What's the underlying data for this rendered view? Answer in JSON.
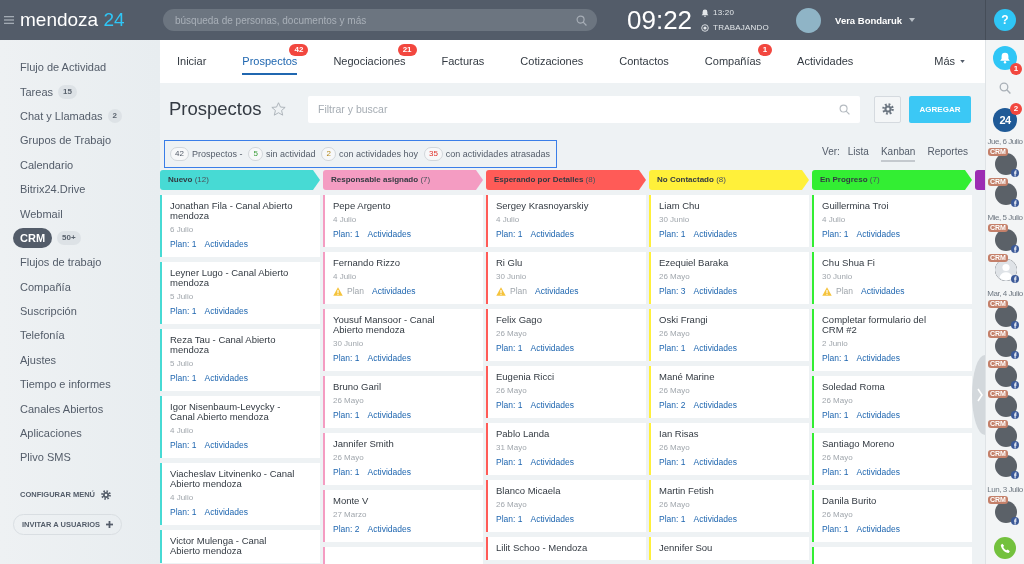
{
  "top_bar": {
    "logo": {
      "name": "mendoza",
      "number": "24"
    },
    "search": {
      "placeholder": "búsqueda de personas, documentos y más"
    },
    "clock": "09:22",
    "alarm": "13:20",
    "status": "TRABAJANDO",
    "user": {
      "name": "Vera Bondaruk"
    }
  },
  "help_button": {
    "label": "?"
  },
  "sidebar": {
    "items": [
      {
        "label": "Flujo de Actividad",
        "selected": false
      },
      {
        "label": "Tareas",
        "count": "15",
        "selected": false
      },
      {
        "label": "Chat y Llamadas",
        "count": "2",
        "selected": false
      },
      {
        "label": "Grupos de Trabajo",
        "selected": false
      },
      {
        "label": "Calendario",
        "selected": false
      },
      {
        "label": "Bitrix24.Drive",
        "selected": false
      },
      {
        "label": "Webmail",
        "selected": false
      },
      {
        "label": "CRM",
        "count": "50+",
        "selected": true
      },
      {
        "label": "Flujos de trabajo",
        "selected": false
      },
      {
        "label": "Compañía",
        "selected": false
      },
      {
        "label": "Suscripción",
        "selected": false
      },
      {
        "label": "Telefonía",
        "selected": false
      },
      {
        "label": "Ajustes",
        "selected": false
      },
      {
        "label": "Tiempo e informes",
        "selected": false
      },
      {
        "label": "Canales Abiertos",
        "selected": false
      },
      {
        "label": "Aplicaciones",
        "selected": false
      },
      {
        "label": "Plivo SMS",
        "selected": false
      }
    ],
    "configure": "CONFIGURAR MENÚ",
    "invite": "INVITAR A USUARIOS"
  },
  "tabs": [
    {
      "label": "Iniciar",
      "selected": false
    },
    {
      "label": "Prospectos",
      "badge": "42",
      "selected": true
    },
    {
      "label": "Negociaciones",
      "badge": "21",
      "selected": false
    },
    {
      "label": "Facturas",
      "selected": false
    },
    {
      "label": "Cotizaciones",
      "selected": false
    },
    {
      "label": "Contactos",
      "selected": false
    },
    {
      "label": "Compañías",
      "badge": "1",
      "selected": false
    },
    {
      "label": "Actividades",
      "selected": false
    }
  ],
  "more_tab": {
    "label": "Más"
  },
  "page": {
    "title": "Prospectos",
    "filter": {
      "placeholder": "Filtrar y buscar"
    },
    "add_button": "AGREGAR"
  },
  "summary": [
    {
      "kind": "total",
      "count": "42",
      "label": "Prospectos -"
    },
    {
      "kind": "idle",
      "count": "5",
      "label": "sin actividad"
    },
    {
      "kind": "today",
      "count": "2",
      "label": "con actividades hoy"
    },
    {
      "kind": "overdue",
      "count": "35",
      "label": "con actividades atrasadas"
    }
  ],
  "views": {
    "label": "Ver:",
    "options": [
      {
        "label": "Lista",
        "selected": false
      },
      {
        "label": "Kanban",
        "selected": true
      },
      {
        "label": "Reportes",
        "selected": false
      }
    ]
  },
  "columns": [
    {
      "title": "Nuevo",
      "count": "(12)",
      "color": "#47dad4",
      "cards": [
        {
          "kind": "lead",
          "name": "Jonathan Fila - Canal Abierto mendoza",
          "date": "6 Julio",
          "plan": "Plan: 1",
          "link": "Actividades",
          "warning": false
        },
        {
          "kind": "lead",
          "name": "Leyner Lugo - Canal Abierto mendoza",
          "date": "5 Julio",
          "plan": "Plan: 1",
          "link": "Actividades",
          "warning": false
        },
        {
          "kind": "lead",
          "name": "Reza Tau - Canal Abierto mendoza",
          "date": "5 Julio",
          "plan": "Plan: 1",
          "link": "Actividades",
          "warning": false
        },
        {
          "kind": "lead",
          "name": "Igor Nisenbaum-Levycky - Canal Abierto mendoza",
          "date": "4 Julio",
          "plan": "Plan: 1",
          "link": "Actividades",
          "warning": false
        },
        {
          "kind": "lead",
          "name": "Viacheslav Litvinenko - Canal Abierto mendoza",
          "date": "4 Julio",
          "plan": "Plan: 1",
          "link": "Actividades",
          "warning": false
        },
        {
          "kind": "lead",
          "name": "Victor Mulenga - Canal Abierto mendoza"
        }
      ]
    },
    {
      "title": "Responsable asignado",
      "count": "(7)",
      "color": "#f49cc2",
      "cards": [
        {
          "kind": "lead",
          "name": "Pepe Argento",
          "date": "4 Julio",
          "plan": "Plan: 1",
          "link": "Actividades",
          "warning": false
        },
        {
          "kind": "lead",
          "name": "Fernando Rizzo",
          "date": "4 Julio",
          "plan": "Plan",
          "link": "Actividades",
          "warning": true
        },
        {
          "kind": "lead",
          "name": "Yousuf Mansoor - Canal Abierto mendoza",
          "date": "30 Junio",
          "plan": "Plan: 1",
          "link": "Actividades",
          "warning": false
        },
        {
          "kind": "lead",
          "name": "Bruno Garil",
          "date": "26 Mayo",
          "plan": "Plan: 1",
          "link": "Actividades",
          "warning": false
        },
        {
          "kind": "lead",
          "name": "Jannifer Smith",
          "date": "26 Mayo",
          "plan": "Plan: 1",
          "link": "Actividades",
          "warning": false
        },
        {
          "kind": "lead",
          "name": "Monte V",
          "date": "27 Marzo",
          "plan": "Plan: 2",
          "link": "Actividades",
          "warning": false
        },
        {
          "kind": "stub"
        }
      ]
    },
    {
      "title": "Esperando por Detalles",
      "count": "(8)",
      "color": "#ff5b57",
      "cards": [
        {
          "kind": "lead",
          "name": "Sergey Krasnoyarskiy",
          "date": "4 Julio",
          "plan": "Plan: 1",
          "link": "Actividades",
          "warning": false
        },
        {
          "kind": "lead",
          "name": "Ri Glu",
          "date": "30 Junio",
          "plan": "Plan",
          "link": "Actividades",
          "warning": true
        },
        {
          "kind": "lead",
          "name": "Felix Gago",
          "date": "26 Mayo",
          "plan": "Plan: 1",
          "link": "Actividades",
          "warning": false
        },
        {
          "kind": "lead",
          "name": "Eugenia Ricci",
          "date": "26 Mayo",
          "plan": "Plan: 1",
          "link": "Actividades",
          "warning": false
        },
        {
          "kind": "lead",
          "name": "Pablo Landa",
          "date": "31 Mayo",
          "plan": "Plan: 1",
          "link": "Actividades",
          "warning": false
        },
        {
          "kind": "lead",
          "name": "Blanco Micaela",
          "date": "26 Mayo",
          "plan": "Plan: 1",
          "link": "Actividades",
          "warning": false
        },
        {
          "kind": "lead",
          "name": "Lilit Schoo - Mendoza"
        }
      ]
    },
    {
      "title": "No Contactado",
      "count": "(8)",
      "color": "#fff03a",
      "cards": [
        {
          "kind": "lead",
          "name": "Liam Chu",
          "date": "30 Junio",
          "plan": "Plan: 1",
          "link": "Actividades",
          "warning": false
        },
        {
          "kind": "lead",
          "name": "Ezequiel Baraka",
          "date": "26 Mayo",
          "plan": "Plan: 3",
          "link": "Actividades",
          "warning": false
        },
        {
          "kind": "lead",
          "name": "Oski Frangi",
          "date": "26 Mayo",
          "plan": "Plan: 1",
          "link": "Actividades",
          "warning": false
        },
        {
          "kind": "lead",
          "name": "Mané Marine",
          "date": "26 Mayo",
          "plan": "Plan: 2",
          "link": "Actividades",
          "warning": false
        },
        {
          "kind": "lead",
          "name": "Ian Risas",
          "date": "26 Mayo",
          "plan": "Plan: 1",
          "link": "Actividades",
          "warning": false
        },
        {
          "kind": "lead",
          "name": "Martin Fetish",
          "date": "26 Mayo",
          "plan": "Plan: 1",
          "link": "Actividades",
          "warning": false
        },
        {
          "kind": "lead",
          "name": "Jennifer Sou"
        }
      ]
    },
    {
      "title": "En Progreso",
      "count": "(7)",
      "color": "#33ee33",
      "cards": [
        {
          "kind": "lead",
          "name": "Guillermina Troi",
          "date": "4 Julio",
          "plan": "Plan: 1",
          "link": "Actividades",
          "warning": false
        },
        {
          "kind": "lead",
          "name": "Chu Shua Fi",
          "date": "30 Junio",
          "plan": "Plan",
          "link": "Actividades",
          "warning": true
        },
        {
          "kind": "lead",
          "name": "Completar formulario del CRM #2",
          "date": "2 Junio",
          "plan": "Plan: 1",
          "link": "Actividades",
          "warning": false
        },
        {
          "kind": "lead",
          "name": "Soledad Roma",
          "date": "26 Mayo",
          "plan": "Plan: 1",
          "link": "Actividades",
          "warning": false
        },
        {
          "kind": "lead",
          "name": "Santiago Moreno",
          "date": "26 Mayo",
          "plan": "Plan: 1",
          "link": "Actividades",
          "warning": false
        },
        {
          "kind": "lead",
          "name": "Danila Burito",
          "date": "26 Mayo",
          "plan": "Plan: 1",
          "link": "Actividades",
          "warning": false
        },
        {
          "kind": "stub"
        }
      ]
    },
    {
      "color": "#9c2db3"
    }
  ],
  "right_bar": {
    "notifications_badge": "1",
    "chat": {
      "label": "24",
      "badge": "2"
    },
    "feed": [
      {
        "kind": "date",
        "text": "Jue, 6 Julio"
      },
      {
        "kind": "contact",
        "badge": "CRM",
        "photo": true
      },
      {
        "kind": "contact",
        "badge": "CRM",
        "photo": true
      },
      {
        "kind": "date",
        "text": "Mie, 5 Julio"
      },
      {
        "kind": "contact",
        "badge": "CRM",
        "photo": true
      },
      {
        "kind": "contact",
        "badge": "CRM",
        "photo": false
      },
      {
        "kind": "date",
        "text": "Mar, 4 Julio"
      },
      {
        "kind": "contact",
        "badge": "CRM",
        "photo": true
      },
      {
        "kind": "contact",
        "badge": "CRM",
        "photo": true
      },
      {
        "kind": "contact",
        "badge": "CRM",
        "photo": true
      },
      {
        "kind": "contact",
        "badge": "CRM",
        "photo": true
      },
      {
        "kind": "contact",
        "badge": "CRM",
        "photo": true
      },
      {
        "kind": "contact",
        "badge": "CRM",
        "photo": true
      },
      {
        "kind": "date",
        "text": "Lun, 3 Julio"
      },
      {
        "kind": "contact",
        "badge": "CRM",
        "photo": true
      }
    ]
  }
}
